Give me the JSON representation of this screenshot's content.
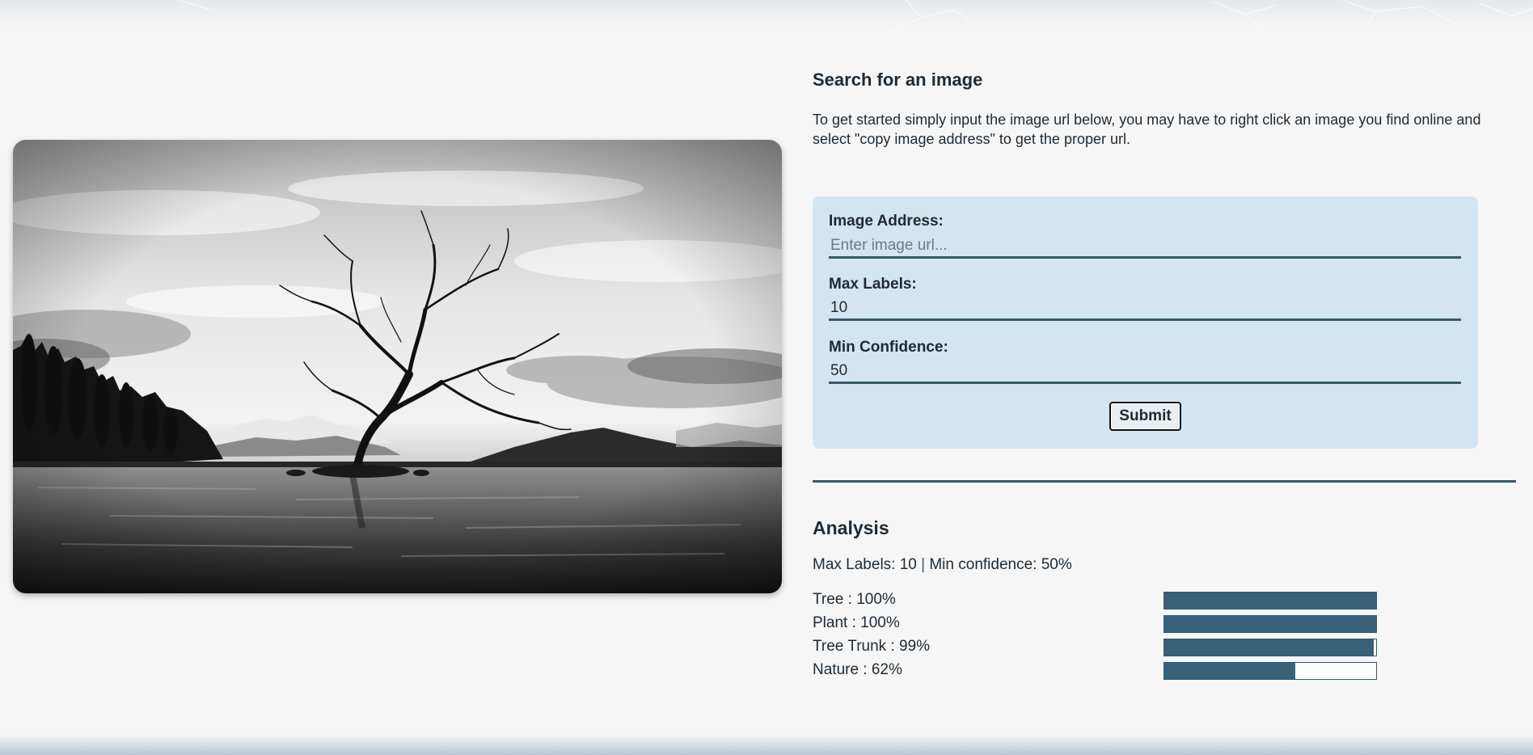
{
  "search": {
    "heading": "Search for an image",
    "intro": "To get started simply input the image url below, you may have to right click an image you find online and select \"copy image address\" to get the proper url."
  },
  "form": {
    "image_address_label": "Image Address:",
    "image_address_placeholder": "Enter image url...",
    "image_address_value": "",
    "max_labels_label": "Max Labels:",
    "max_labels_value": "10",
    "min_confidence_label": "Min Confidence:",
    "min_confidence_value": "50",
    "submit_label": "Submit"
  },
  "analysis": {
    "heading": "Analysis",
    "summary_max": "Max Labels: 10",
    "summary_separator": "|",
    "summary_min": "Min confidence: 50%",
    "results": [
      {
        "text": "Tree : 100%",
        "value": 100
      },
      {
        "text": "Plant : 100%",
        "value": 100
      },
      {
        "text": "Tree Trunk : 99%",
        "value": 99
      },
      {
        "text": "Nature : 62%",
        "value": 62
      }
    ]
  },
  "colors": {
    "accent": "#36586e",
    "bar_fill": "#38617a",
    "card_bg": "#d3e5f0",
    "page_bg": "#f6f6f6"
  },
  "icons": {
    "photo": "lone-tree-lake-photo"
  }
}
